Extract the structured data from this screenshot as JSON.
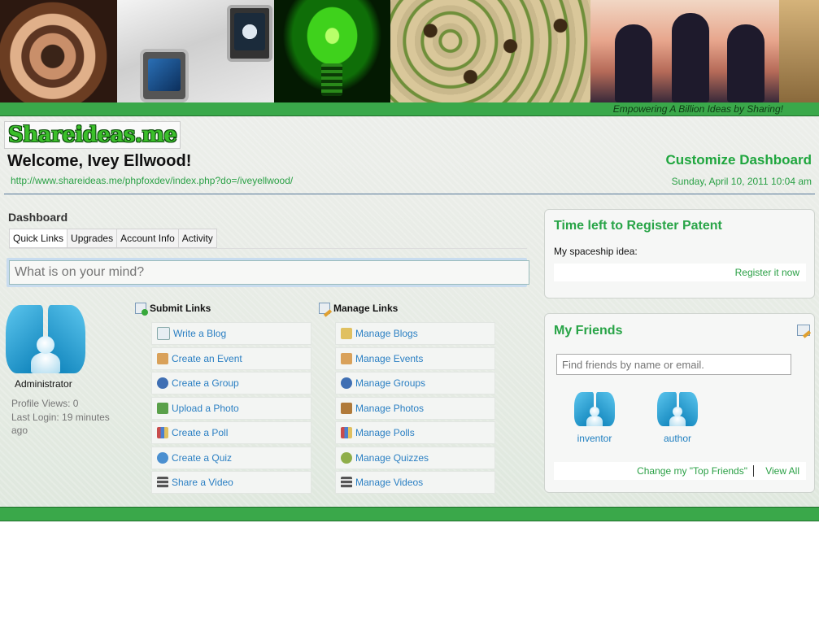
{
  "site": {
    "logo_text": "Shareideas.me",
    "tagline": "Empowering A Billion Ideas by Sharing!"
  },
  "header": {
    "welcome": "Welcome, Ivey Ellwood!",
    "profile_url": "http://www.shareideas.me/phpfoxdev/index.php?do=/iveyellwood/",
    "customize_label": "Customize Dashboard",
    "date": "Sunday, April 10, 2011 10:04 am"
  },
  "dashboard": {
    "title": "Dashboard",
    "tabs": [
      {
        "label": "Quick Links",
        "active": true
      },
      {
        "label": "Upgrades",
        "active": false
      },
      {
        "label": "Account Info",
        "active": false
      },
      {
        "label": "Activity",
        "active": false
      }
    ],
    "status_placeholder": "What is on your mind?"
  },
  "user": {
    "role": "Administrator",
    "profile_views": "Profile Views: 0",
    "last_login": "Last Login: 19 minutes ago"
  },
  "submit_links": {
    "title": "Submit Links",
    "items": [
      {
        "label": "Write a Blog",
        "icon": "blog-add-icon",
        "color": "#e6eef3"
      },
      {
        "label": "Create an Event",
        "icon": "event-add-icon",
        "color": "#d9a15a"
      },
      {
        "label": "Create a Group",
        "icon": "group-add-icon",
        "color": "#3f6fb3"
      },
      {
        "label": "Upload a Photo",
        "icon": "photo-add-icon",
        "color": "#5aa04a"
      },
      {
        "label": "Create a Poll",
        "icon": "poll-add-icon",
        "color": "#c84c4c"
      },
      {
        "label": "Create a Quiz",
        "icon": "quiz-add-icon",
        "color": "#4a8fd0"
      },
      {
        "label": "Share a Video",
        "icon": "video-add-icon",
        "color": "#555555"
      }
    ]
  },
  "manage_links": {
    "title": "Manage Links",
    "items": [
      {
        "label": "Manage Blogs",
        "icon": "blog-edit-icon",
        "color": "#e0c060"
      },
      {
        "label": "Manage Events",
        "icon": "event-edit-icon",
        "color": "#d9a15a"
      },
      {
        "label": "Manage Groups",
        "icon": "group-edit-icon",
        "color": "#3f6fb3"
      },
      {
        "label": "Manage Photos",
        "icon": "photo-edit-icon",
        "color": "#b07a3a"
      },
      {
        "label": "Manage Polls",
        "icon": "poll-edit-icon",
        "color": "#c84c4c"
      },
      {
        "label": "Manage Quizzes",
        "icon": "quiz-edit-icon",
        "color": "#8fae4a"
      },
      {
        "label": "Manage Videos",
        "icon": "video-edit-icon",
        "color": "#555555"
      }
    ]
  },
  "patent": {
    "title": "Time left to Register Patent",
    "idea": "My spaceship idea:",
    "register_label": "Register it now"
  },
  "friends": {
    "title": "My Friends",
    "search_placeholder": "Find friends by name or email.",
    "list": [
      {
        "name": "inventor"
      },
      {
        "name": "author"
      }
    ],
    "top_friends_label": "Change my \"Top Friends\"",
    "view_all_label": "View All"
  },
  "colors": {
    "brand_green": "#3aa84a",
    "link_green": "#2aa045",
    "link_blue": "#2a7fc3"
  }
}
